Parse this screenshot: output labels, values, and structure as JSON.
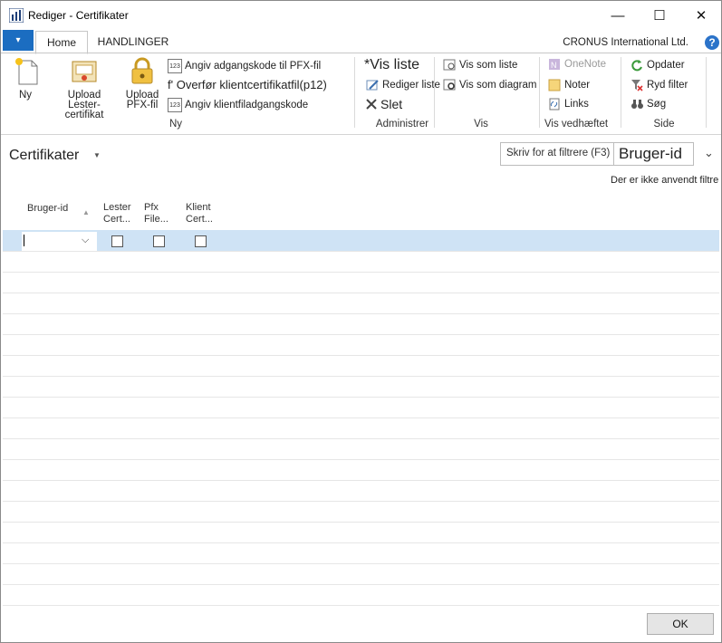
{
  "window": {
    "title": "Rediger - Certifikater",
    "minimize": "—",
    "maximize": "☐",
    "close": "✕"
  },
  "ribbon_tabs": {
    "file_icon": "▾",
    "home": "Home",
    "actions": "HANDLINGER"
  },
  "company": "CRONUS International Ltd.",
  "help": "?",
  "ribbon": {
    "ny_group": {
      "label": "Ny",
      "new": "Ny",
      "upload_lester": "Upload Lester-certifikat",
      "upload_pfx": "Upload PFX-fil",
      "set_pfx_password": "Angiv adgangskode til PFX-fil",
      "transfer_client_cert": "f' Overfør klientcertifikatfil(p12)",
      "set_client_password": "Angiv klientfiladgangskode"
    },
    "administrer_group": {
      "label": "Administrer",
      "show_list": "*Vis liste",
      "edit_list": "Rediger liste",
      "delete": "Slet"
    },
    "vis_group": {
      "label": "Vis",
      "view_as_list": "Vis som liste",
      "view_as_chart": "Vis som diagram"
    },
    "attached_group": {
      "label": "Vis vedhæftet",
      "onenote": "OneNote",
      "notes": "Noter",
      "links": "Links"
    },
    "side_group": {
      "label": "Side",
      "refresh": "Opdater",
      "clear_filter": "Ryd filter",
      "search": "Søg"
    }
  },
  "page": {
    "title": "Certifikater",
    "filter_placeholder": "Skriv for at filtrere (F3)",
    "filter_field": "Bruger-id",
    "no_filter": "Der er ikke anvendt filtre"
  },
  "table": {
    "columns": [
      "Bruger-id",
      "Lester Cert...",
      "Pfx File...",
      "Klient Cert..."
    ]
  },
  "footer": {
    "ok": "OK"
  }
}
